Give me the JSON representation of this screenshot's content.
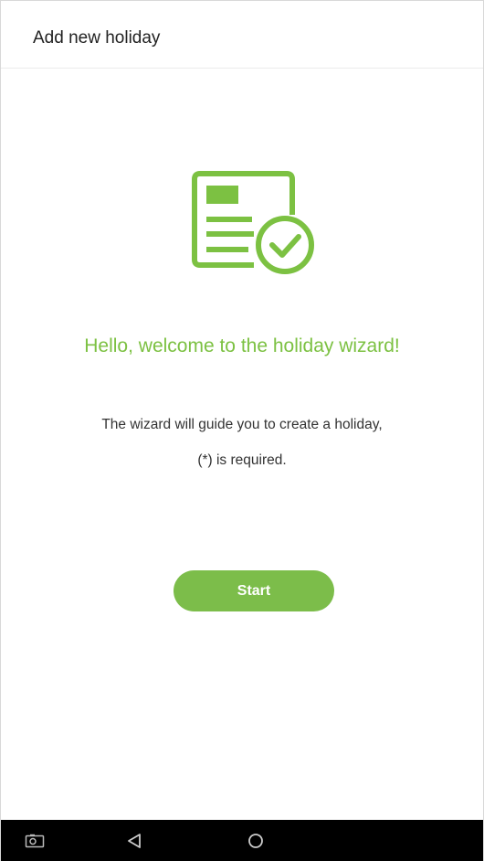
{
  "header": {
    "title": "Add new holiday"
  },
  "main": {
    "icon": "holiday-wizard-document-check-icon",
    "welcome_text": "Hello, welcome to the holiday wizard!",
    "description_line1": "The wizard will guide you to create a holiday,",
    "description_line2": "(*) is required.",
    "start_label": "Start"
  },
  "navbar": {
    "items": [
      "camera-icon",
      "back-icon",
      "home-icon"
    ]
  },
  "colors": {
    "accent": "#7cc142",
    "button": "#7cbd4a",
    "navbar": "#000000"
  }
}
